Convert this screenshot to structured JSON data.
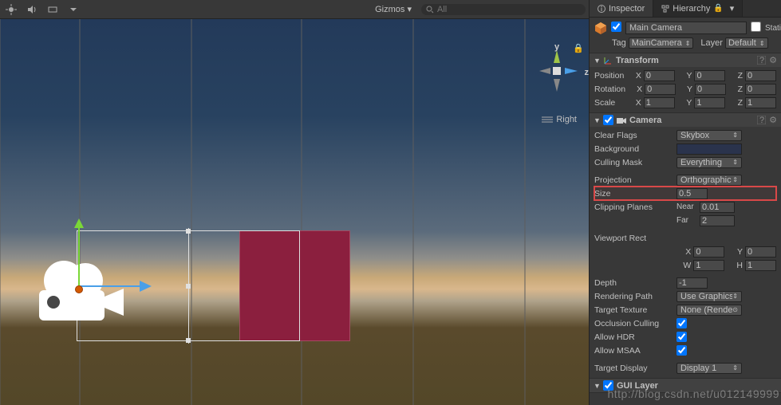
{
  "toolbar": {
    "gizmos": "Gizmos",
    "search_placeholder": "All"
  },
  "compass": {
    "y": "y",
    "x": "",
    "z": "z",
    "mode": "Right"
  },
  "tabs": {
    "inspector": "Inspector",
    "hierarchy": "Hierarchy"
  },
  "gameobject": {
    "name": "Main Camera",
    "static": "Static",
    "tag_lbl": "Tag",
    "tag_val": "MainCamera",
    "layer_lbl": "Layer",
    "layer_val": "Default"
  },
  "transform": {
    "title": "Transform",
    "pos_lbl": "Position",
    "rot_lbl": "Rotation",
    "scl_lbl": "Scale",
    "pos": [
      "0",
      "0",
      "0"
    ],
    "rot": [
      "0",
      "0",
      "0"
    ],
    "scl": [
      "1",
      "1",
      "1"
    ],
    "axis": [
      "X",
      "Y",
      "Z"
    ]
  },
  "camera": {
    "title": "Camera",
    "clearflags_lbl": "Clear Flags",
    "clearflags_val": "Skybox",
    "background_lbl": "Background",
    "cullingmask_lbl": "Culling Mask",
    "cullingmask_val": "Everything",
    "projection_lbl": "Projection",
    "projection_val": "Orthographic",
    "size_lbl": "Size",
    "size_val": "0.5",
    "clip_lbl": "Clipping Planes",
    "near_lbl": "Near",
    "near_val": "0.01",
    "far_lbl": "Far",
    "far_val": "2",
    "viewport_lbl": "Viewport Rect",
    "vx": "0",
    "vy": "0",
    "vw": "1",
    "vh": "1",
    "depth_lbl": "Depth",
    "depth_val": "-1",
    "rendpath_lbl": "Rendering Path",
    "rendpath_val": "Use Graphics Settings",
    "targettex_lbl": "Target Texture",
    "targettex_val": "None (Render Texture)",
    "occ_lbl": "Occlusion Culling",
    "hdr_lbl": "Allow HDR",
    "msaa_lbl": "Allow MSAA",
    "targdisplay_lbl": "Target Display",
    "targdisplay_val": "Display 1"
  },
  "guilayer": {
    "title": "GUI Layer"
  },
  "watermark": "http://blog.csdn.net/u012149999",
  "axis_short": {
    "x": "X",
    "y": "Y",
    "w": "W",
    "h": "H"
  }
}
